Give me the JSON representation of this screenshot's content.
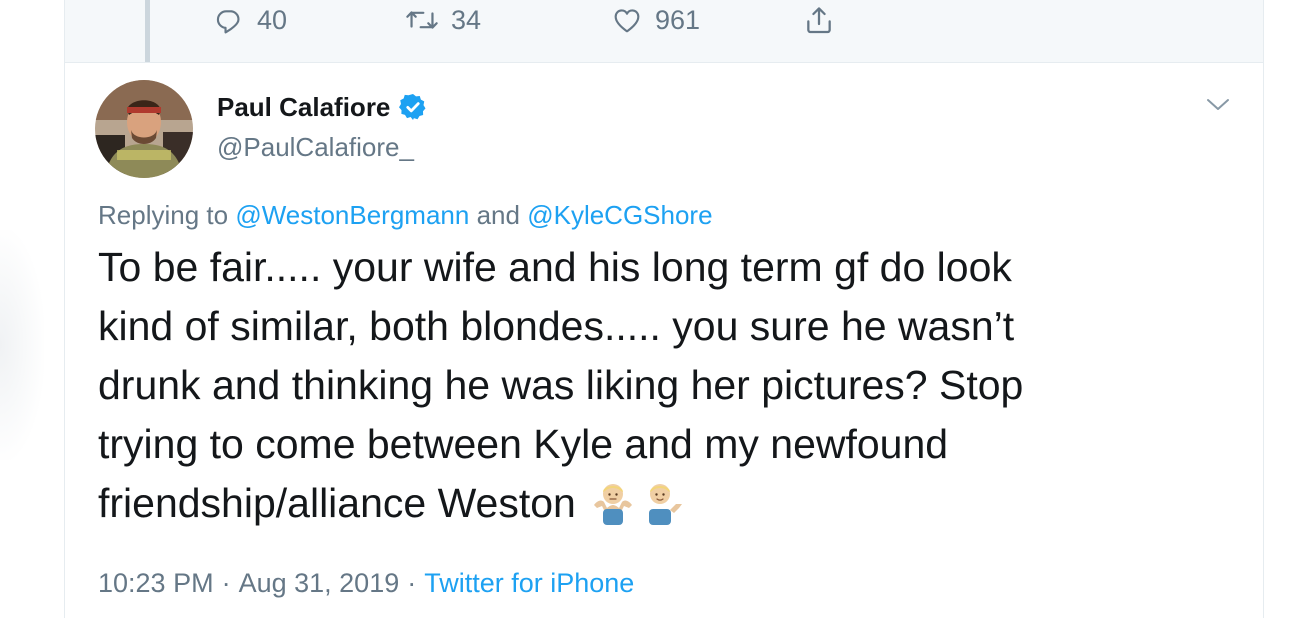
{
  "parent_tweet": {
    "reply_count": "40",
    "retweet_count": "34",
    "like_count": "961"
  },
  "tweet": {
    "display_name": "Paul Calafiore",
    "handle": "@PaulCalafiore_",
    "replying_prefix": "Replying to",
    "reply_mention_1": "@WestonBergmann",
    "reply_and": "and",
    "reply_mention_2": "@KyleCGShore",
    "text_lines": [
      "To be fair..... your wife and his long term gf do look",
      "kind of similar, both blondes..... you sure he wasn’t",
      "drunk and thinking he was liking her pictures? Stop",
      "trying to come between Kyle and my newfound",
      "friendship/alliance Weston"
    ],
    "emojis": [
      "shrug-emoji",
      "tipping-hand-emoji"
    ],
    "time": "10:23 PM",
    "date": "Aug 31, 2019",
    "source": "Twitter for iPhone",
    "separator": "·"
  },
  "icons": {
    "reply": "reply-icon",
    "retweet": "retweet-icon",
    "like": "heart-icon",
    "share": "share-icon",
    "verified": "verified-badge-icon",
    "caret": "chevron-down-icon"
  },
  "colors": {
    "link": "#1da1f2",
    "muted": "#657786",
    "text": "#14171a",
    "thread_bg": "#f5f8fa"
  }
}
